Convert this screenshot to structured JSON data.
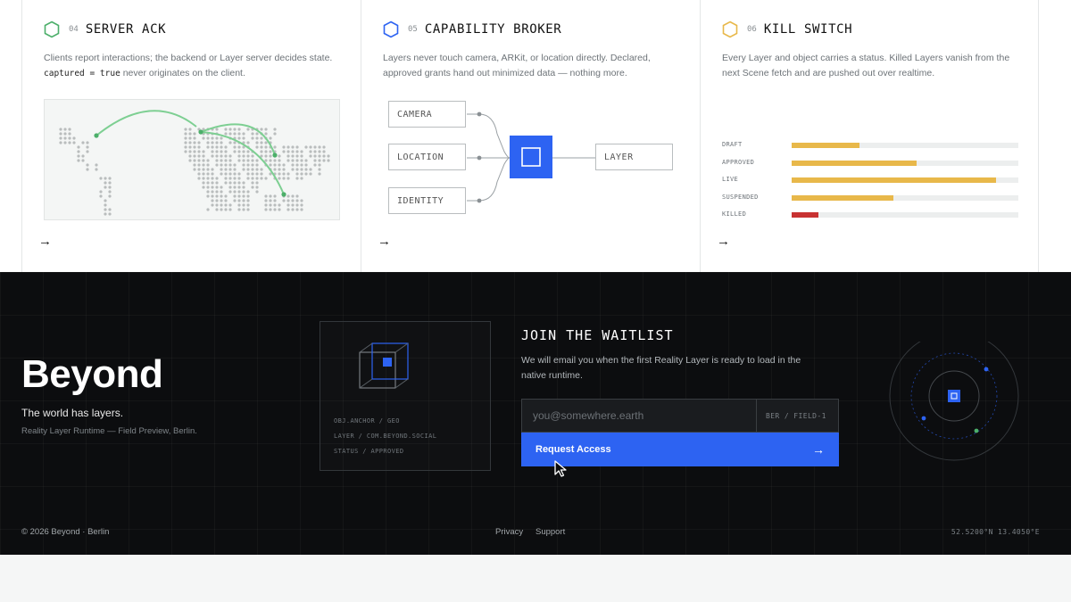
{
  "cards": [
    {
      "number": "04",
      "title": "SERVER ACK",
      "accent": "#4caf6a",
      "description_pre": "Clients report interactions; the backend or Layer server decides state.",
      "description_code": "captured = true",
      "description_post": "never originates on the client.",
      "arrow": "→"
    },
    {
      "number": "05",
      "title": "CAPABILITY BROKER",
      "accent": "#2d63f2",
      "description": "Layers never touch camera, ARKit, or location directly. Declared, approved grants hand out minimized data — nothing more.",
      "inputs": [
        "CAMERA",
        "LOCATION",
        "IDENTITY"
      ],
      "output": "LAYER",
      "arrow": "→"
    },
    {
      "number": "06",
      "title": "KILL SWITCH",
      "accent": "#e8b84a",
      "description": "Every Layer and object carries a status. Killed Layers vanish from the next Scene fetch and are pushed out over realtime.",
      "statuses": [
        {
          "label": "DRAFT",
          "fraction": 0.3,
          "color": "#e8b84a"
        },
        {
          "label": "APPROVED",
          "fraction": 0.55,
          "color": "#e8b84a"
        },
        {
          "label": "LIVE",
          "fraction": 0.9,
          "color": "#e8b84a"
        },
        {
          "label": "SUSPENDED",
          "fraction": 0.45,
          "color": "#e8b84a"
        },
        {
          "label": "KILLED",
          "fraction": 0.12,
          "color": "#c83232"
        }
      ],
      "arrow": "→"
    }
  ],
  "footer": {
    "brand": "Beyond",
    "tagline": "The world has layers.",
    "subtagline": "Reality Layer Runtime — Field Preview, Berlin.",
    "anchor_meta": [
      "OBJ.ANCHOR / GEO",
      "LAYER / COM.BEYOND.SOCIAL",
      "STATUS / APPROVED"
    ],
    "waitlist": {
      "title": "JOIN THE WAITLIST",
      "description": "We will email you when the first Reality Layer is ready to load in the native runtime.",
      "email_placeholder": "you@somewhere.earth",
      "field_tag": "BER / FIELD-1",
      "button_label": "Request Access",
      "button_arrow": "→"
    },
    "copyright": "© 2026 Beyond · Berlin",
    "links": [
      "Privacy",
      "Support"
    ],
    "coordinates": "52.5200°N 13.4050°E",
    "accent": "#2d63f2"
  }
}
